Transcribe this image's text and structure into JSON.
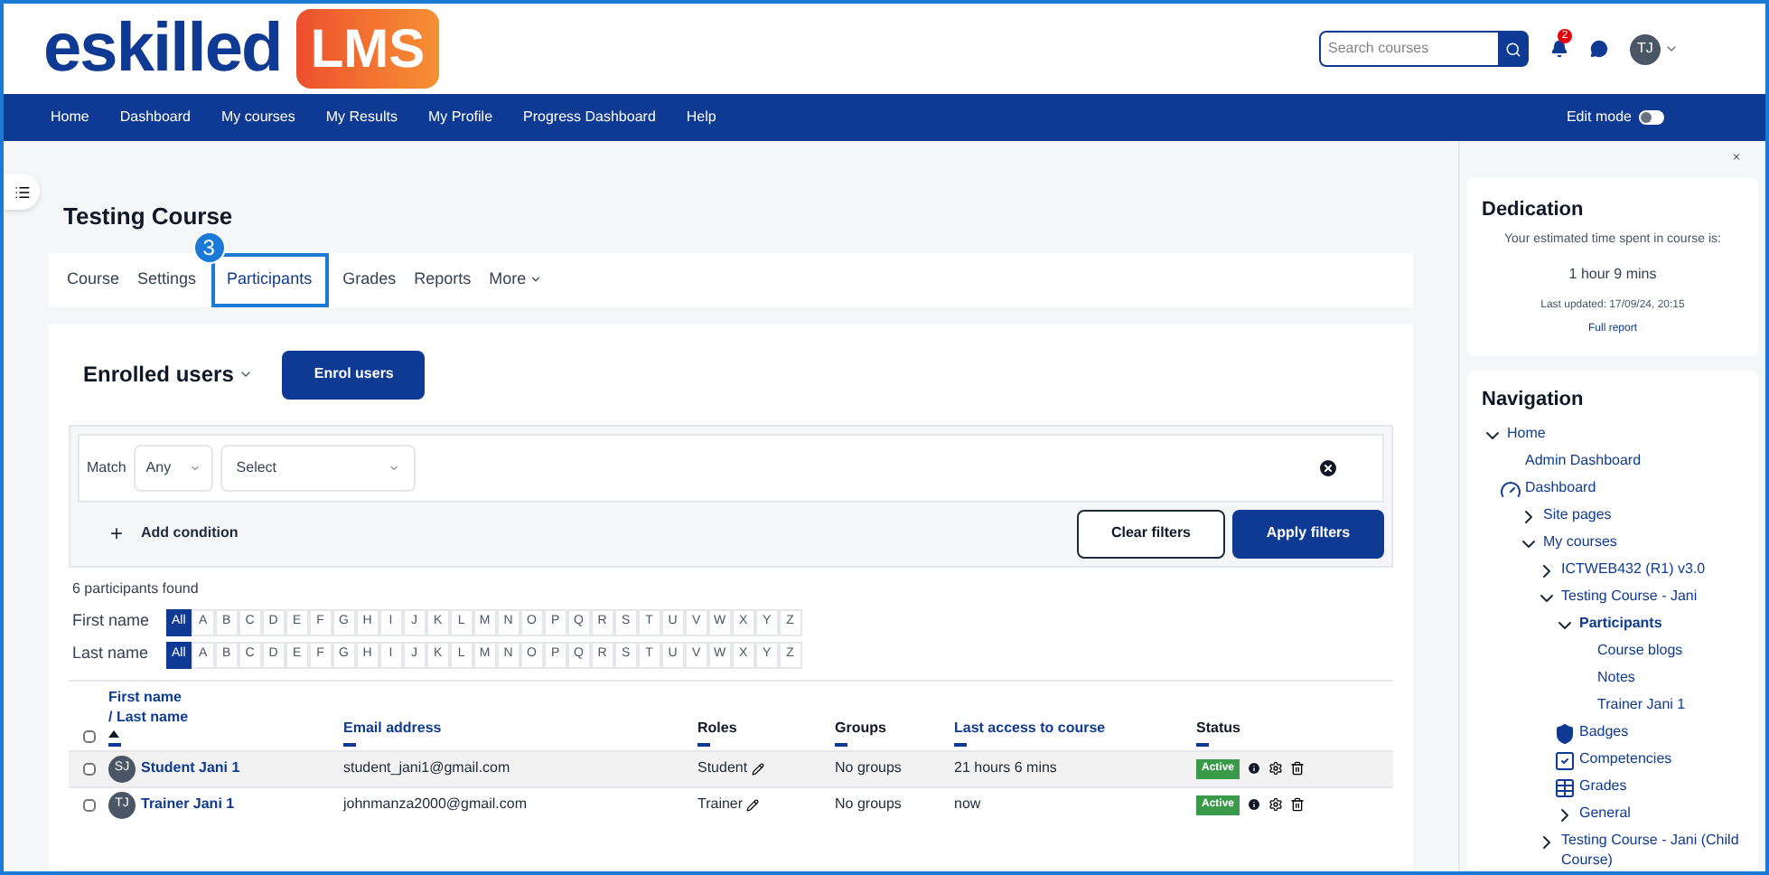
{
  "logo": {
    "name": "eskilled",
    "badge": "LMS"
  },
  "search": {
    "placeholder": "Search courses"
  },
  "notifications": {
    "count": "2"
  },
  "user": {
    "initials": "TJ"
  },
  "menu": [
    {
      "label": "Home"
    },
    {
      "label": "Dashboard"
    },
    {
      "label": "My courses"
    },
    {
      "label": "My Results"
    },
    {
      "label": "My Profile"
    },
    {
      "label": "Progress Dashboard"
    },
    {
      "label": "Help"
    }
  ],
  "edit_mode": {
    "label": "Edit mode",
    "on": false
  },
  "course": {
    "title": "Testing Course"
  },
  "tabs": [
    {
      "label": "Course",
      "selected": false
    },
    {
      "label": "Settings",
      "selected": false
    },
    {
      "label": "Participants",
      "selected": true,
      "callout": "3"
    },
    {
      "label": "Grades",
      "selected": false
    },
    {
      "label": "Reports",
      "selected": false
    },
    {
      "label": "More",
      "selected": false,
      "dropdown": true
    }
  ],
  "heading": {
    "label": "Enrolled users",
    "button": "Enrol users"
  },
  "filter": {
    "match_label": "Match",
    "match_value": "Any",
    "select_value": "Select",
    "add_condition": "Add condition",
    "add_icon": "+",
    "clear": "Clear filters",
    "apply": "Apply filters"
  },
  "found": "6 participants found",
  "initials_bars": [
    {
      "label": "First name",
      "letters": [
        {
          "label": "All",
          "selected": true
        },
        {
          "label": "A",
          "selected": false
        },
        {
          "label": "B",
          "selected": false
        },
        {
          "label": "C",
          "selected": false
        },
        {
          "label": "D",
          "selected": false
        },
        {
          "label": "E",
          "selected": false
        },
        {
          "label": "F",
          "selected": false
        },
        {
          "label": "G",
          "selected": false
        },
        {
          "label": "H",
          "selected": false
        },
        {
          "label": "I",
          "selected": false
        },
        {
          "label": "J",
          "selected": false
        },
        {
          "label": "K",
          "selected": false
        },
        {
          "label": "L",
          "selected": false
        },
        {
          "label": "M",
          "selected": false
        },
        {
          "label": "N",
          "selected": false
        },
        {
          "label": "O",
          "selected": false
        },
        {
          "label": "P",
          "selected": false
        },
        {
          "label": "Q",
          "selected": false
        },
        {
          "label": "R",
          "selected": false
        },
        {
          "label": "S",
          "selected": false
        },
        {
          "label": "T",
          "selected": false
        },
        {
          "label": "U",
          "selected": false
        },
        {
          "label": "V",
          "selected": false
        },
        {
          "label": "W",
          "selected": false
        },
        {
          "label": "X",
          "selected": false
        },
        {
          "label": "Y",
          "selected": false
        },
        {
          "label": "Z",
          "selected": false
        }
      ]
    },
    {
      "label": "Last name",
      "letters": [
        {
          "label": "All",
          "selected": true
        },
        {
          "label": "A",
          "selected": false
        },
        {
          "label": "B",
          "selected": false
        },
        {
          "label": "C",
          "selected": false
        },
        {
          "label": "D",
          "selected": false
        },
        {
          "label": "E",
          "selected": false
        },
        {
          "label": "F",
          "selected": false
        },
        {
          "label": "G",
          "selected": false
        },
        {
          "label": "H",
          "selected": false
        },
        {
          "label": "I",
          "selected": false
        },
        {
          "label": "J",
          "selected": false
        },
        {
          "label": "K",
          "selected": false
        },
        {
          "label": "L",
          "selected": false
        },
        {
          "label": "M",
          "selected": false
        },
        {
          "label": "N",
          "selected": false
        },
        {
          "label": "O",
          "selected": false
        },
        {
          "label": "P",
          "selected": false
        },
        {
          "label": "Q",
          "selected": false
        },
        {
          "label": "R",
          "selected": false
        },
        {
          "label": "S",
          "selected": false
        },
        {
          "label": "T",
          "selected": false
        },
        {
          "label": "U",
          "selected": false
        },
        {
          "label": "V",
          "selected": false
        },
        {
          "label": "W",
          "selected": false
        },
        {
          "label": "X",
          "selected": false
        },
        {
          "label": "Y",
          "selected": false
        },
        {
          "label": "Z",
          "selected": false
        }
      ]
    }
  ],
  "table": {
    "select_all_checked": false,
    "columns": [
      {
        "label": "First name",
        "label2": "/ Last name",
        "link": true,
        "sorted": true
      },
      {
        "label": "Email address",
        "link": true,
        "sorted": false
      },
      {
        "label": "Roles",
        "link": false
      },
      {
        "label": "Groups",
        "link": false
      },
      {
        "label": "Last access to course",
        "link": true,
        "sorted": false
      },
      {
        "label": "Status",
        "link": false
      }
    ],
    "rows": [
      {
        "initials": "SJ",
        "name": "Student Jani 1",
        "email": "student_jani1@gmail.com",
        "role": "Student",
        "groups": "No groups",
        "last_access": "21 hours 6 mins",
        "status": "Active",
        "checked": false
      },
      {
        "initials": "TJ",
        "name": "Trainer Jani 1",
        "email": "johnmanza2000@gmail.com",
        "role": "Trainer",
        "groups": "No groups",
        "last_access": "now",
        "status": "Active",
        "checked": false
      }
    ]
  },
  "dedication": {
    "title": "Dedication",
    "intro": "Your estimated time spent in course is:",
    "time": "1 hour 9 mins",
    "updated": "Last updated: 17/09/24, 20:15",
    "link": "Full report"
  },
  "navigation": {
    "title": "Navigation",
    "items": [
      {
        "label": "Home",
        "expanded": true,
        "kind": "node",
        "children": [
          {
            "label": "Admin Dashboard",
            "kind": "leaf"
          },
          {
            "label": "Dashboard",
            "kind": "dashboard",
            "children": [
              {
                "label": "Site pages",
                "expanded": false,
                "kind": "node"
              },
              {
                "label": "My courses",
                "expanded": true,
                "kind": "node",
                "children": [
                  {
                    "label": "ICTWEB432 (R1) v3.0",
                    "expanded": false,
                    "kind": "node"
                  },
                  {
                    "label": "Testing Course - Jani",
                    "expanded": true,
                    "kind": "node",
                    "children": [
                      {
                        "label": "Participants",
                        "expanded": true,
                        "kind": "node",
                        "bold": true,
                        "children": [
                          {
                            "label": "Course blogs",
                            "kind": "leaf"
                          },
                          {
                            "label": "Notes",
                            "kind": "leaf"
                          },
                          {
                            "label": "Trainer Jani 1",
                            "kind": "leaf"
                          }
                        ]
                      },
                      {
                        "label": "Badges",
                        "kind": "badge"
                      },
                      {
                        "label": "Competencies",
                        "kind": "competency"
                      },
                      {
                        "label": "Grades",
                        "kind": "grades"
                      },
                      {
                        "label": "General",
                        "expanded": false,
                        "kind": "node"
                      }
                    ]
                  },
                  {
                    "label": "Testing Course - Jani (Child Course)",
                    "expanded": false,
                    "kind": "node"
                  }
                ]
              }
            ]
          }
        ]
      }
    ]
  }
}
